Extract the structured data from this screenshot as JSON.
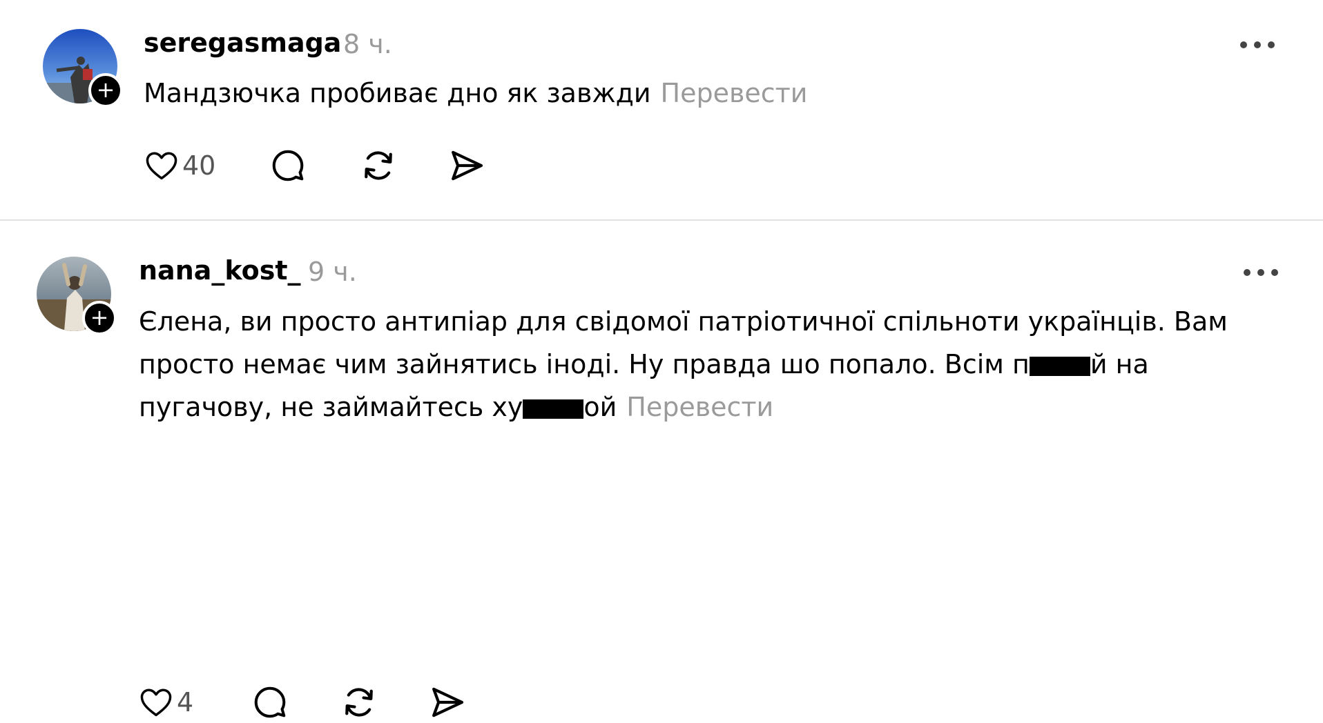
{
  "comments": [
    {
      "username": "seregasmaga",
      "time": "8 ч.",
      "text": "Мандзючка пробиває дно як завжди",
      "translate_label": "Перевести",
      "likes": "40",
      "avatar_colors": [
        "#1e4fbf",
        "#9cc8ee",
        "#3a3a3a"
      ]
    },
    {
      "username": "nana_kost_",
      "time": "9 ч.",
      "text_part1": "Єлена, ви просто антипіар для свідомої патріотичної спільноти українців. Вам просто немає чим зайнятись іноді. Ну правда шо попало. Всім п",
      "text_part2": "й на пугачову, не займайтесь ху",
      "text_part3": "ой",
      "translate_label": "Перевести",
      "likes": "4",
      "avatar_colors": [
        "#7a8a96",
        "#c9b79a",
        "#4a3e33"
      ]
    }
  ],
  "icons": {
    "follow": "plus-badge-icon",
    "more": "more-options-icon",
    "like": "heart-icon",
    "reply": "comment-icon",
    "repost": "repost-icon",
    "share": "send-icon"
  }
}
